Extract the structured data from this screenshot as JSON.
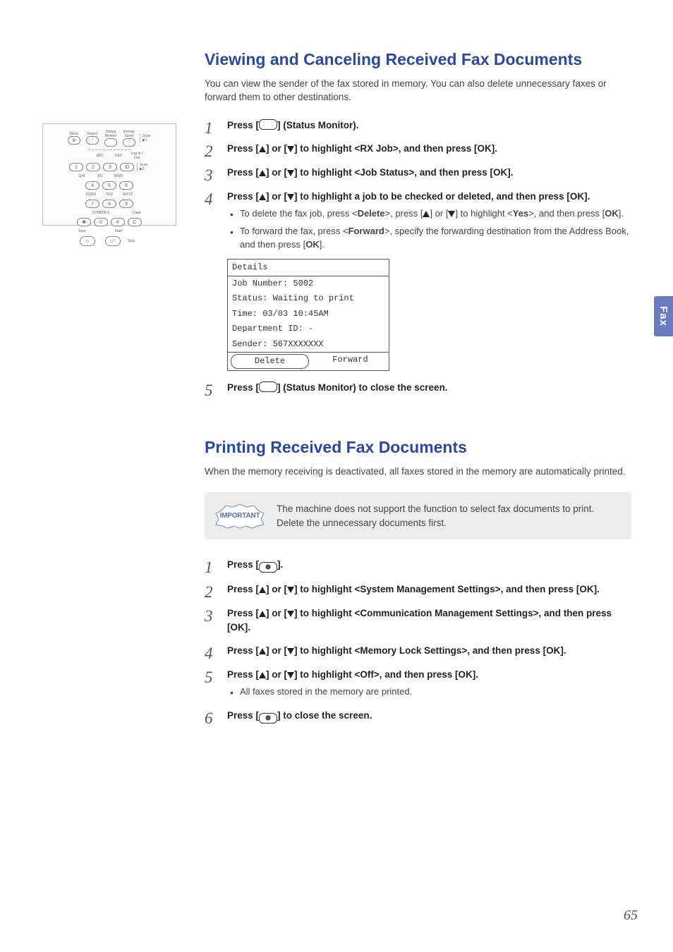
{
  "side_tab": "Fax",
  "page_number": "65",
  "section1": {
    "title": "Viewing and Canceling Received Fax Documents",
    "intro": "You can view the sender of the fax stored in memory. You can also delete unnecessary faxes or forward them to other destinations.",
    "steps": {
      "s1": {
        "pre": "Press [",
        "post": "] (Status Monitor)."
      },
      "s2": {
        "pre": "Press [",
        "mid": "] or [",
        "post": "] to highlight <RX Job>, and then press [OK]."
      },
      "s3": {
        "pre": "Press [",
        "mid": "] or [",
        "post": "] to highlight <Job Status>, and then press [OK]."
      },
      "s4": {
        "pre": "Press [",
        "mid": "] or [",
        "post": "] to highlight a job to be checked or deleted, and then press [OK].",
        "bullets": {
          "b1": {
            "t1": "To delete the fax job, press <",
            "bold1": "Delete",
            "t2": ">, press [",
            "t3": "] or [",
            "t4": "] to highlight <",
            "bold2": "Yes",
            "t5": ">, and then press [",
            "bold3": "OK",
            "t6": "]."
          },
          "b2": {
            "t1": "To forward the fax, press <",
            "bold1": "Forward",
            "t2": ">, specify the forwarding destination from the Address Book, and then press [",
            "bold2": "OK",
            "t3": "]."
          }
        },
        "lcd": {
          "title": "Details",
          "rows": {
            "r1": "Job Number: 5002",
            "r2": "Status: Waiting to print",
            "r3": "Time: 03/03 10:45AM",
            "r4": "Department ID: -",
            "r5": "Sender: 567XXXXXXX"
          },
          "btn_left": "Delete",
          "btn_right": "Forward"
        }
      },
      "s5": {
        "pre": "Press [",
        "post": "] (Status Monitor) to close the screen."
      }
    }
  },
  "section2": {
    "title": "Printing Received Fax Documents",
    "intro": "When the memory receiving is deactivated, all faxes stored in the memory are automatically printed.",
    "important_label": "IMPORTANT",
    "important_text": "The machine does not support the function to select fax documents to print. Delete the unnecessary documents first.",
    "steps": {
      "s1": {
        "pre": "Press [",
        "post": "]."
      },
      "s2": {
        "pre": "Press [",
        "mid": "] or [",
        "post": "] to highlight <System Management Settings>, and then press [OK]."
      },
      "s3": {
        "pre": "Press [",
        "mid": "] or [",
        "post": "] to highlight <Communication Management Settings>, and then press [OK]."
      },
      "s4": {
        "pre": "Press [",
        "mid": "] or [",
        "post": "] to highlight <Memory Lock Settings>, and then press [OK]."
      },
      "s5": {
        "pre": "Press [",
        "mid": "] or [",
        "post": "] to highlight <Off>, and then press [OK].",
        "bullet": "All faxes stored in the memory are printed."
      },
      "s6": {
        "pre": "Press [",
        "post": "] to close the screen."
      }
    }
  },
  "panel": {
    "labels": {
      "menu": "Menu",
      "report": "Report",
      "status": "Status Monitor",
      "energy": "Energy Saver",
      "abc": "ABC",
      "def": "DEF",
      "login": "Log In / Out",
      "ghi": "GHI",
      "jkl": "JKL",
      "mno": "MNO",
      "pqrs": "PQRS",
      "tuv": "TUV",
      "wxyz": "WXYZ",
      "symbols": "SYMBOLS",
      "clear": "Clear",
      "tone": "Tone",
      "start": "Start",
      "stop": "Stop",
      "scan1": "Scan ▶1",
      "scan2": "Scan ▶2"
    }
  }
}
